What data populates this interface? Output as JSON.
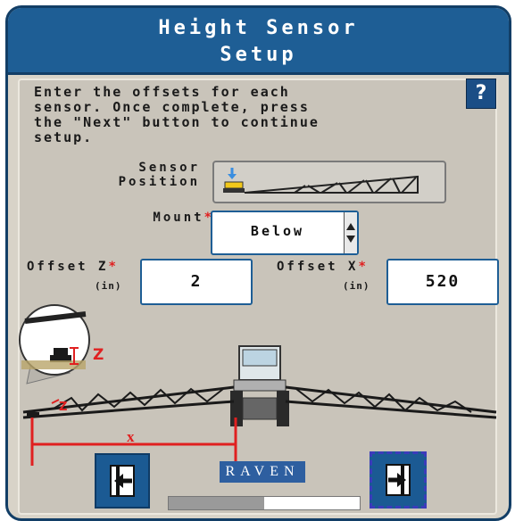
{
  "title": {
    "line1": "Height Sensor",
    "line2": "Setup"
  },
  "instructions": "Enter the offsets for each\nsensor. Once complete, press\nthe \"Next\" button to continue\nsetup.",
  "help": {
    "label": "?"
  },
  "sensor_position": {
    "label_line1": "Sensor",
    "label_line2": "Position"
  },
  "mount": {
    "label": "Mount",
    "required_marker": "*",
    "value": "Below"
  },
  "offset_z": {
    "label": "Offset Z",
    "required_marker": "*",
    "unit": "(in)",
    "value": "2"
  },
  "offset_x": {
    "label": "Offset X",
    "required_marker": "*",
    "unit": "(in)",
    "value": "520"
  },
  "diagram": {
    "z_label": "Z",
    "x_label": "x"
  },
  "logo": {
    "text": "RAVEN"
  },
  "progress": {
    "fraction": 0.5
  },
  "colors": {
    "title_bg": "#1e5e95",
    "accent_red": "#e02020",
    "button_blue": "#1b5a93"
  }
}
